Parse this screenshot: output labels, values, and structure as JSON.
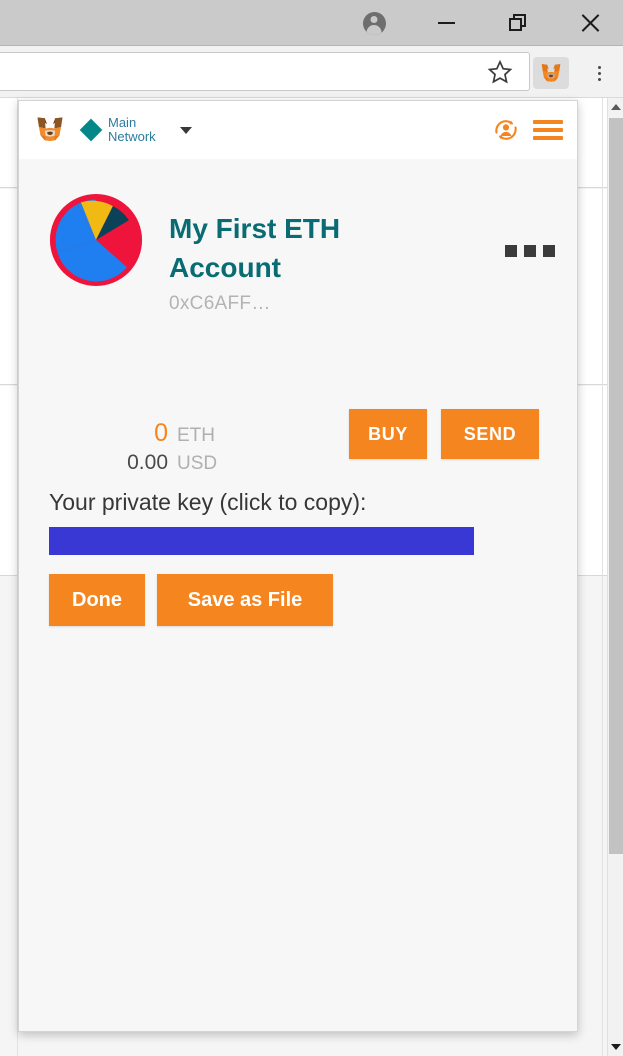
{
  "window": {
    "controls": [
      {
        "name": "profile",
        "icon": "profile-icon",
        "label": "Profile"
      },
      {
        "name": "minimize",
        "icon": "minimize-icon",
        "label": "Minimize"
      },
      {
        "name": "maximize",
        "icon": "restore-icon",
        "label": "Restore"
      },
      {
        "name": "close",
        "icon": "close-icon",
        "label": "Close"
      }
    ]
  },
  "browser": {
    "address_value": "",
    "address_placeholder": "",
    "bookmark_icon": "star-icon",
    "extension_icon": "metamask-fox-icon",
    "menu_icon": "kebab-menu-icon"
  },
  "scrollbar": {
    "up_icon": "triangle-up-icon",
    "down_icon": "triangle-down-icon"
  },
  "popup": {
    "header": {
      "logo_icon": "metamask-fox-icon",
      "network_icon": "network-diamond-icon",
      "network_name": "Main Network",
      "network_caret_icon": "chevron-down-icon",
      "switch_account_icon": "switch-account-icon",
      "menu_icon": "hamburger-menu-icon"
    },
    "account": {
      "identicon": "account-identicon",
      "name": "My First ETH Account",
      "address": "0xC6AFF…",
      "options_icon": "three-dots-icon"
    },
    "balance": {
      "eth_amount": "0",
      "eth_unit": "ETH",
      "usd_amount": "0.00",
      "usd_unit": "USD"
    },
    "actions": {
      "buy_label": "BUY",
      "send_label": "SEND"
    },
    "private_key": {
      "label": "Your private key (click to copy):",
      "value": "",
      "selected": true
    },
    "footer": {
      "done_label": "Done",
      "save_label": "Save as File"
    }
  },
  "colors": {
    "accent_orange": "#f5861f",
    "teal_heading": "#0a6c73",
    "network_teal": "#038789",
    "network_text": "#2d7c9e",
    "private_key_highlight": "#3a38d4",
    "popup_bg": "#f7f7f7",
    "titlebar_bg": "#cacaca",
    "toolbar_bg": "#f2f2f2"
  },
  "identicon_segments": [
    {
      "name": "base-crimson",
      "color": "#ee143c"
    },
    {
      "name": "wedge-blue",
      "color": "#1f7ff0"
    },
    {
      "name": "wedge-yellow",
      "color": "#f0b913"
    },
    {
      "name": "wedge-navy",
      "color": "#0c4257"
    }
  ]
}
